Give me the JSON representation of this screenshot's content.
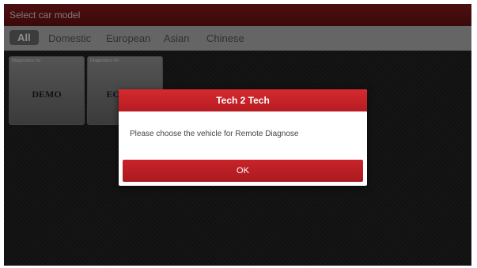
{
  "header": {
    "title": "Select car model"
  },
  "tabs": [
    {
      "label": "All",
      "active": true
    },
    {
      "label": "Domestic"
    },
    {
      "label": "European"
    },
    {
      "label": "Asian"
    },
    {
      "label": "Chinese"
    }
  ],
  "cards": [
    {
      "caption": "Diagnostics for",
      "name": "DEMO"
    },
    {
      "caption": "Diagnostics for",
      "name": "ECUAID"
    }
  ],
  "dialog": {
    "title": "Tech 2 Tech",
    "message": "Please choose the vehicle for Remote Diagnose",
    "ok_label": "OK"
  },
  "colors": {
    "title_bar": "#7a1719",
    "tab_bar": "#b9b9b9",
    "accent_red": "#c8242a",
    "background": "#1e1e1e"
  }
}
